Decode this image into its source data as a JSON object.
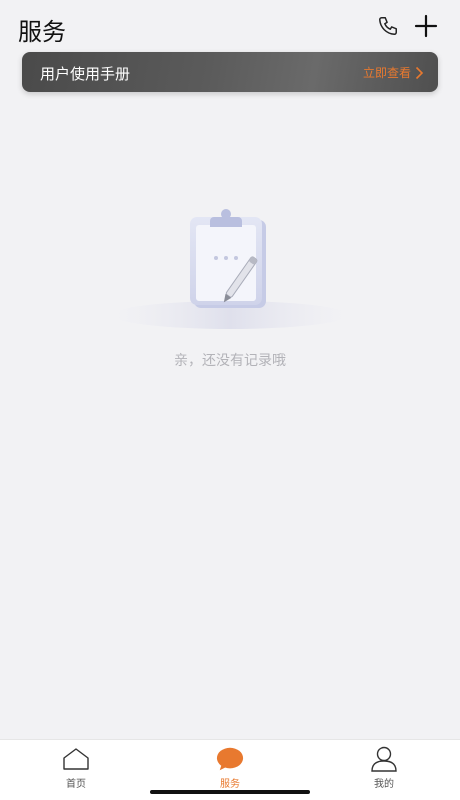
{
  "header": {
    "title": "服务",
    "phone_icon": "phone-icon",
    "add_icon": "plus-icon"
  },
  "banner": {
    "title": "用户使用手册",
    "link_label": "立即查看",
    "link_color": "#e8792f"
  },
  "empty_state": {
    "illustration": "clipboard-with-pen",
    "message": "亲，还没有记录哦"
  },
  "tabbar": {
    "active_color": "#e8792f",
    "items": [
      {
        "label": "首页",
        "icon": "home-icon",
        "active": false
      },
      {
        "label": "服务",
        "icon": "chat-bubble-icon",
        "active": true
      },
      {
        "label": "我的",
        "icon": "user-icon",
        "active": false
      }
    ]
  }
}
